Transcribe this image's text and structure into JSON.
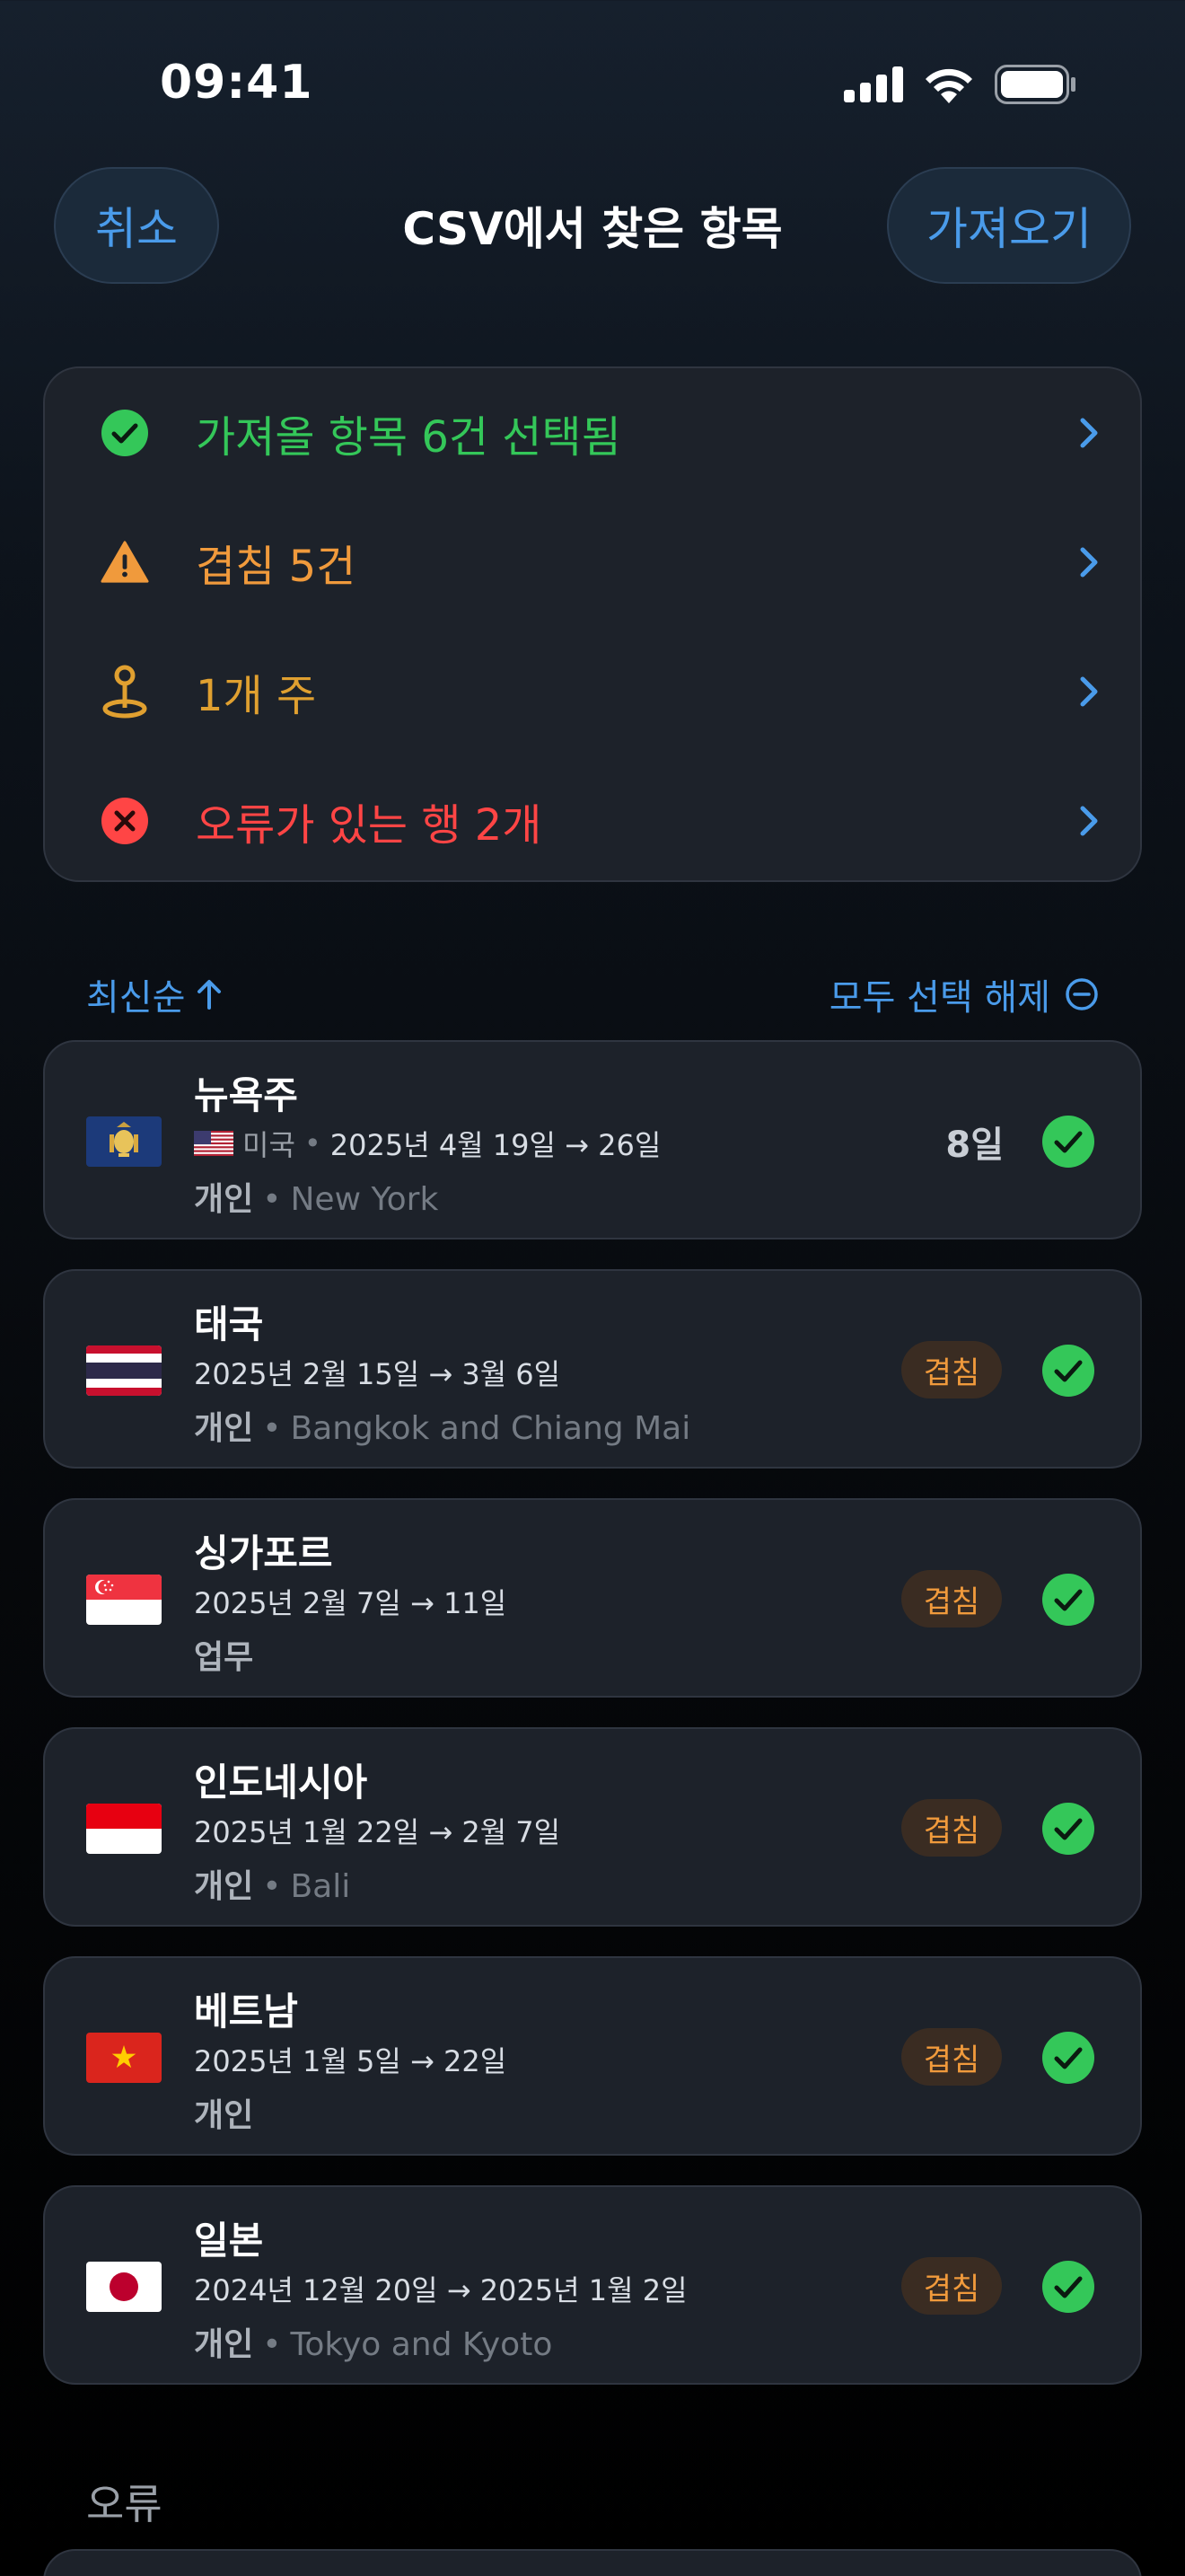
{
  "status_bar": {
    "time": "09:41"
  },
  "nav": {
    "cancel_label": "취소",
    "title": "CSV에서 찾은 항목",
    "import_label": "가져오기"
  },
  "summary": {
    "items": [
      {
        "label": "가져올 항목 6건 선택됨",
        "color": "#34c759",
        "icon": "check-circle-icon"
      },
      {
        "label": "겹침 5건",
        "color": "#f09a3c",
        "icon": "warning-icon"
      },
      {
        "label": "1개 주",
        "color": "#e0a030",
        "icon": "location-pin-icon"
      },
      {
        "label": "오류가 있는 행 2개",
        "color": "#ff4545",
        "icon": "error-circle-icon"
      }
    ]
  },
  "sort": {
    "order_label": "최신순",
    "deselect_label": "모두 선택 해제"
  },
  "trips": [
    {
      "title": "뉴욕주",
      "country": "미국",
      "dates": "2025년 4월 19일 → 26일",
      "purpose": "개인",
      "location": "New York",
      "days": "8일",
      "flag": "new-york"
    },
    {
      "title": "태국",
      "dates": "2025년 2월 15일 → 3월 6일",
      "purpose": "개인",
      "location": "Bangkok and Chiang Mai",
      "badge": "겹침",
      "flag": "thailand"
    },
    {
      "title": "싱가포르",
      "dates": "2025년 2월 7일 → 11일",
      "purpose": "업무",
      "badge": "겹침",
      "flag": "singapore"
    },
    {
      "title": "인도네시아",
      "dates": "2025년 1월 22일 → 2월 7일",
      "purpose": "개인",
      "location": "Bali",
      "badge": "겹침",
      "flag": "indonesia"
    },
    {
      "title": "베트남",
      "dates": "2025년 1월 5일 → 22일",
      "purpose": "개인",
      "badge": "겹침",
      "flag": "vietnam"
    },
    {
      "title": "일본",
      "dates": "2024년 12월 20일 → 2025년 1월 2일",
      "purpose": "개인",
      "location": "Tokyo and Kyoto",
      "badge": "겹침",
      "flag": "japan"
    }
  ],
  "errors": {
    "heading": "오류"
  },
  "colors": {
    "accent": "#4a9bea",
    "success": "#34c759",
    "warning": "#f09a3c",
    "error": "#ff4545",
    "card": "#1d222a"
  }
}
